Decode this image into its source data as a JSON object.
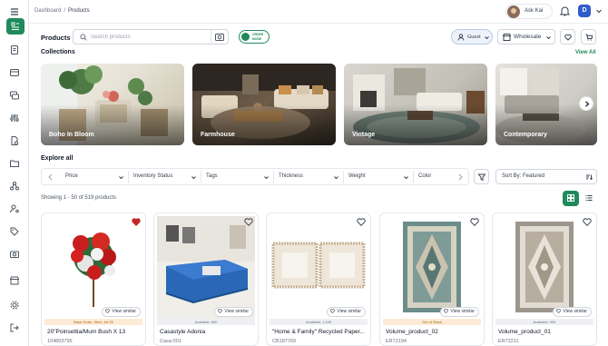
{
  "app": {
    "breadcrumb": [
      "Dashboard",
      "Products"
    ],
    "breadcrumb_sep": "/",
    "user_name": "Ask Kai",
    "user_initial": "D",
    "accent": "#1f8a5b"
  },
  "products_bar": {
    "title": "Products",
    "search_placeholder": "Search products",
    "order_mode": "ORDER MODE",
    "guest_label": "Guest",
    "price_mode": "Wholesale"
  },
  "collections": {
    "title": "Collections",
    "view_all": "View All",
    "items": [
      {
        "label": "Boho In Bloom"
      },
      {
        "label": "Farmhouse"
      },
      {
        "label": "Vintage"
      },
      {
        "label": "Contemporary"
      }
    ]
  },
  "explore": {
    "title": "Explore all",
    "filters": [
      "Price",
      "Inventory Status",
      "Tags",
      "Thickness",
      "Weight",
      "Color"
    ],
    "sort_label": "Sort By: Featured",
    "showing": "Showing 1 - 50 of 519 products"
  },
  "products": [
    {
      "name": "20\"Poinsettia/Mum Bush X 13",
      "sku": "104803796",
      "status": "Back Order: Wed, Jul 25",
      "status_type": "warn",
      "view_similar": "View similar",
      "favorited": true
    },
    {
      "name": "Casastyle Adonia",
      "sku": "Casa-001",
      "status": "Available: 850",
      "status_type": "ok",
      "view_similar": "View similar",
      "favorited": false
    },
    {
      "name": "\"Home & Family\" Recycled Paper...",
      "sku": "CB187769",
      "status": "Available: 1,049",
      "status_type": "ok",
      "view_similar": "View similar",
      "favorited": false
    },
    {
      "name": "Volume_product_02",
      "sku": "ER72194",
      "status": "Out of Stock",
      "status_type": "warn",
      "view_similar": "View similar",
      "favorited": false
    },
    {
      "name": "Volume_product_01",
      "sku": "ER72211",
      "status": "Available: 994",
      "status_type": "ok",
      "view_similar": "View similar",
      "favorited": false
    }
  ]
}
